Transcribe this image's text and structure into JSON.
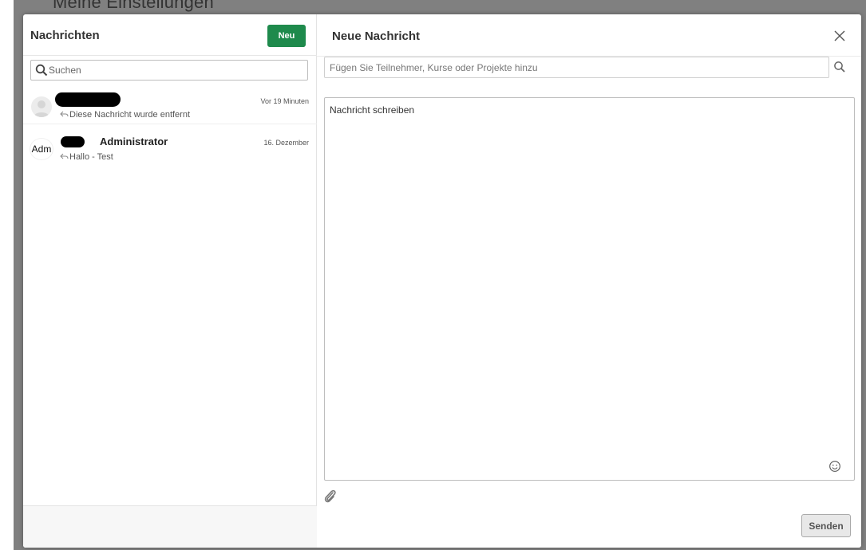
{
  "background": {
    "page_title": "Meine Einstellungen"
  },
  "left": {
    "title": "Nachrichten",
    "new_label": "Neu",
    "search_placeholder": "Suchen"
  },
  "conversations": [
    {
      "avatar_icon": "user-placeholder-icon",
      "time": "Vor 19 Minuten",
      "preview": "Diese Nachricht wurde entfernt"
    },
    {
      "avatar_text": "Adm",
      "name": "Administrator",
      "time": "16. Dezember",
      "preview": "Hallo - Test"
    }
  ],
  "compose": {
    "title": "Neue Nachricht",
    "recipients_placeholder": "Fügen Sie Teilnehmer, Kurse oder Projekte hinzu",
    "message_placeholder": "Nachricht schreiben",
    "send_label": "Senden"
  },
  "colors": {
    "accent": "#1e8a4c"
  }
}
